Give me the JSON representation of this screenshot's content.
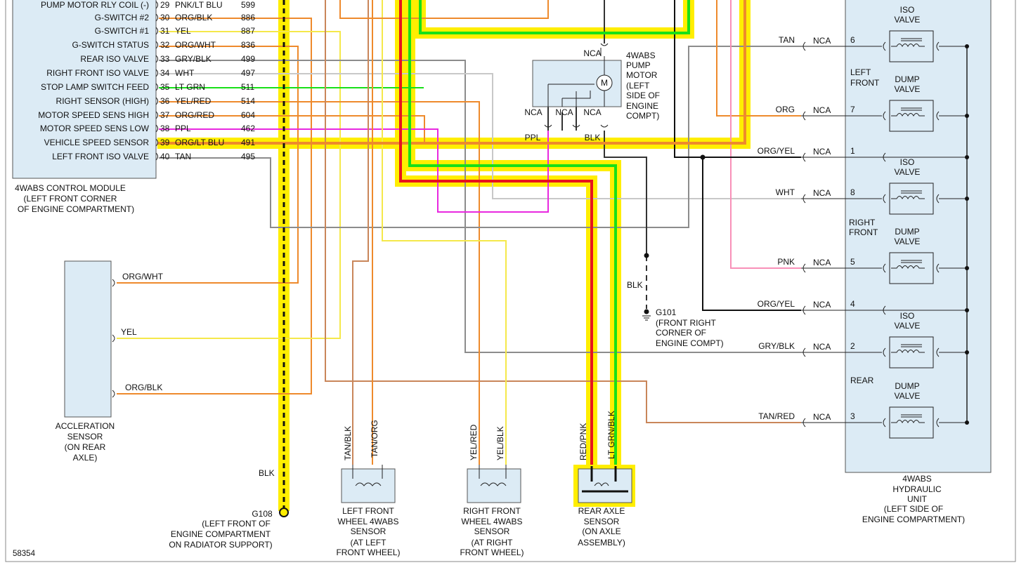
{
  "module": {
    "pins": [
      {
        "num": "29",
        "name": "PUMP MOTOR RLY COIL (-)",
        "color": "PNK/LT BLU",
        "circuit": "599"
      },
      {
        "num": "30",
        "name": "G-SWITCH #2",
        "color": "ORG/BLK",
        "circuit": "886"
      },
      {
        "num": "31",
        "name": "G-SWITCH #1",
        "color": "YEL",
        "circuit": "887"
      },
      {
        "num": "32",
        "name": "G-SWITCH STATUS",
        "color": "ORG/WHT",
        "circuit": "836"
      },
      {
        "num": "33",
        "name": "REAR ISO VALVE",
        "color": "GRY/BLK",
        "circuit": "499"
      },
      {
        "num": "34",
        "name": "RIGHT FRONT ISO VALVE",
        "color": "WHT",
        "circuit": "497"
      },
      {
        "num": "35",
        "name": "STOP LAMP SWITCH FEED",
        "color": "LT GRN",
        "circuit": "511"
      },
      {
        "num": "36",
        "name": "RIGHT SENSOR (HIGH)",
        "color": "YEL/RED",
        "circuit": "514"
      },
      {
        "num": "37",
        "name": "MOTOR SPEED SENS HIGH",
        "color": "ORG/RED",
        "circuit": "604"
      },
      {
        "num": "38",
        "name": "MOTOR SPEED SENS LOW",
        "color": "PPL",
        "circuit": "462"
      },
      {
        "num": "39",
        "name": "VEHICLE SPEED SENSOR",
        "color": "ORG/LT BLU",
        "circuit": "491"
      },
      {
        "num": "40",
        "name": "LEFT FRONT ISO VALVE",
        "color": "TAN",
        "circuit": "495"
      }
    ],
    "caption": [
      "4WABS CONTROL MODULE",
      "(LEFT FRONT CORNER",
      "OF ENGINE COMPARTMENT)"
    ]
  },
  "accel": {
    "wires": [
      "ORG/WHT",
      "YEL",
      "ORG/BLK"
    ],
    "caption": [
      "ACCLERATION",
      "SENSOR",
      "(ON REAR",
      "AXLE)"
    ]
  },
  "ground108": {
    "wire": "BLK",
    "caption": [
      "G108",
      "(LEFT FRONT OF",
      "ENGINE COMPARTMENT",
      "ON RADIATOR SUPPORT)"
    ]
  },
  "lf_sensor": {
    "wires": [
      "TAN/BLK",
      "TAN/ORG"
    ],
    "caption": [
      "LEFT FRONT",
      "WHEEL 4WABS",
      "SENSOR",
      "(AT LEFT",
      "FRONT WHEEL)"
    ]
  },
  "rf_sensor": {
    "wires": [
      "YEL/RED",
      "YEL/BLK"
    ],
    "caption": [
      "RIGHT FRONT",
      "WHEEL 4WABS",
      "SENSOR",
      "(AT RIGHT",
      "FRONT WHEEL)"
    ]
  },
  "rear_sensor": {
    "wires": [
      "RED/PNK",
      "LT GRN/BLK"
    ],
    "caption": [
      "REAR AXLE",
      "SENSOR",
      "(ON AXLE",
      "ASSEMBLY)"
    ]
  },
  "pump": {
    "nca": "NCA",
    "caption": [
      "4WABS",
      "PUMP",
      "MOTOR",
      "(LEFT",
      "SIDE OF",
      "ENGINE",
      "COMPT)"
    ],
    "motor": "M",
    "wire_ppl": "PPL",
    "wire_blk": "BLK"
  },
  "g101": {
    "wire": "BLK",
    "caption": [
      "G101",
      "(FRONT RIGHT",
      "CORNER OF",
      "ENGINE COMPT)"
    ]
  },
  "hcu": {
    "pins": [
      {
        "wire": "TAN",
        "nca": "NCA",
        "num": "6"
      },
      {
        "wire": "ORG",
        "nca": "NCA",
        "num": "7"
      },
      {
        "wire": "ORG/YEL",
        "nca": "NCA",
        "num": "1"
      },
      {
        "wire": "WHT",
        "nca": "NCA",
        "num": "8"
      },
      {
        "wire": "PNK",
        "nca": "NCA",
        "num": "5"
      },
      {
        "wire": "ORG/YEL",
        "nca": "NCA",
        "num": "4"
      },
      {
        "wire": "GRY/BLK",
        "nca": "NCA",
        "num": "2"
      },
      {
        "wire": "TAN/RED",
        "nca": "NCA",
        "num": "3"
      }
    ],
    "valves": [
      [
        "ISO",
        "VALVE"
      ],
      [
        "DUMP",
        "VALVE"
      ],
      [
        "ISO",
        "VALVE"
      ],
      [
        "DUMP",
        "VALVE"
      ],
      [
        "ISO",
        "VALVE"
      ],
      [
        "DUMP",
        "VALVE"
      ]
    ],
    "groups": [
      [
        "LEFT",
        "FRONT"
      ],
      [
        "RIGHT",
        "FRONT"
      ],
      [
        "REAR"
      ]
    ],
    "caption": [
      "4WABS",
      "HYDRAULIC",
      "UNIT",
      "(LEFT SIDE OF",
      "ENGINE COMPARTMENT)"
    ]
  },
  "figure_id": "58354",
  "colors": {
    "org": "#ee8a2c",
    "yel": "#f5e84a",
    "hi": "#ffee00",
    "red": "#e8141c",
    "grn": "#18e018",
    "mag": "#e828e0",
    "gry": "#8c8c8c",
    "tan": "#c9865a",
    "pink": "#f890b8",
    "blk": "#111111",
    "box": "#dcebf5"
  }
}
